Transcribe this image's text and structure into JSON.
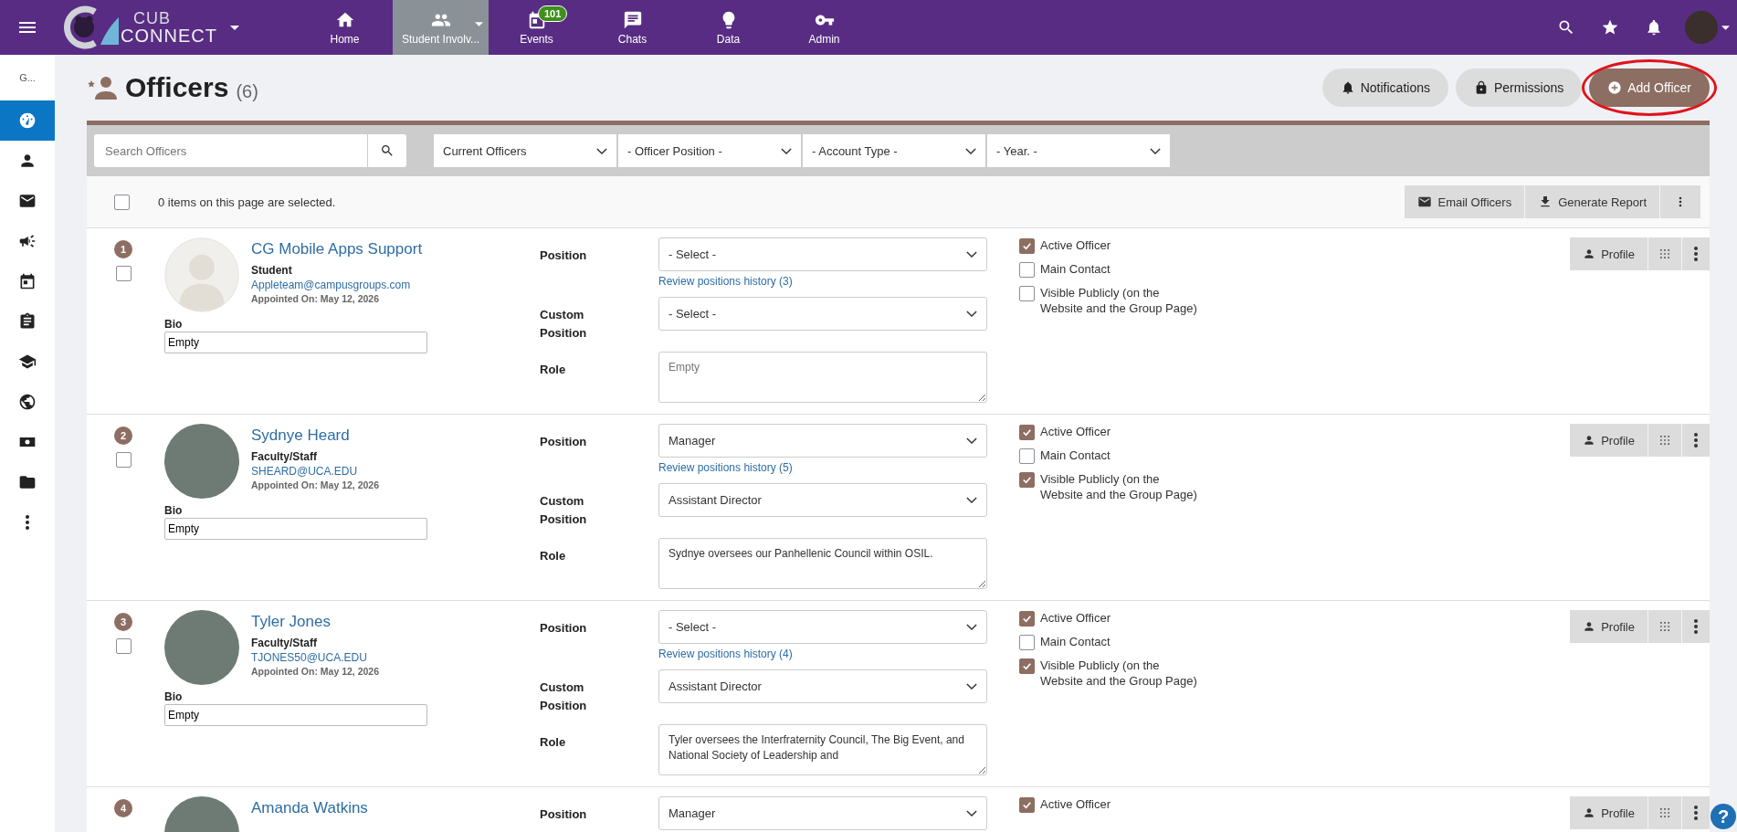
{
  "topbar": {
    "logo": {
      "line1": "CUB",
      "line2": "CONNECT"
    },
    "nav": [
      {
        "kind": "home",
        "label": "Home",
        "selected": false
      },
      {
        "kind": "group",
        "label": "Student Involv...",
        "selected": true,
        "dropdown": true
      },
      {
        "kind": "event",
        "label": "Events",
        "selected": false,
        "badge": "101"
      },
      {
        "kind": "chat",
        "label": "Chats",
        "selected": false
      },
      {
        "kind": "bulb",
        "label": "Data",
        "selected": false
      },
      {
        "kind": "key",
        "label": "Admin",
        "selected": false
      }
    ],
    "tools": [
      {
        "kind": "search"
      },
      {
        "kind": "star"
      },
      {
        "kind": "bell"
      }
    ]
  },
  "sidebar": {
    "label": "G...",
    "items": [
      {
        "kind": "dashboard",
        "selected": true
      },
      {
        "kind": "person",
        "selected": false
      },
      {
        "kind": "mail",
        "selected": false
      },
      {
        "kind": "megaphone",
        "selected": false
      },
      {
        "kind": "event",
        "selected": false
      },
      {
        "kind": "clipboard",
        "selected": false
      },
      {
        "kind": "school",
        "selected": false
      },
      {
        "kind": "globe",
        "selected": false
      },
      {
        "kind": "money",
        "selected": false
      },
      {
        "kind": "folder",
        "selected": false
      },
      {
        "kind": "more",
        "selected": false
      }
    ]
  },
  "page": {
    "title": "Officers",
    "count": "(6)",
    "buttons": [
      {
        "kind": "bell",
        "label": "Notifications",
        "primary": false,
        "highlighted": false
      },
      {
        "kind": "lock",
        "label": "Permissions",
        "primary": false,
        "highlighted": false
      },
      {
        "kind": "add",
        "label": "Add Officer",
        "primary": true,
        "highlighted": true
      }
    ]
  },
  "filters": {
    "search_placeholder": "Search Officers",
    "selects": [
      "Current Officers",
      "- Officer Position -",
      "- Account Type -",
      "- Year. -"
    ]
  },
  "selection": {
    "checked": false,
    "text": "0 items on this page are selected.",
    "actions": [
      {
        "kind": "mail",
        "label": "Email Officers"
      },
      {
        "kind": "download",
        "label": "Generate Report"
      },
      {
        "kind": "more"
      }
    ]
  },
  "officers": [
    {
      "number": "1",
      "kind": "placeholder",
      "name": "CG Mobile Apps Support",
      "type": "Student",
      "email": "Appleteam@campusgroups.com",
      "appointed": "Appointed On: May 12, 2026",
      "checked": false,
      "bio_label": "Bio",
      "bio": "Empty",
      "position_label": "Position",
      "position": "- Select -",
      "history": "Review positions history (3)",
      "custom_label": "Custom Position",
      "custom": "- Select -",
      "role_label": "Role",
      "role_placeholder": "Empty",
      "flags": [
        {
          "label": "Active Officer",
          "checked": true
        },
        {
          "label": "Main Contact",
          "checked": false
        },
        {
          "label": "Visible Publicly (on the Website and the Group Page)",
          "checked": false
        }
      ],
      "profile": "Profile"
    },
    {
      "number": "2",
      "kind": "photo",
      "name": "Sydnye Heard",
      "type": "Faculty/Staff",
      "email": "SHEARD@UCA.EDU",
      "appointed": "Appointed On: May 12, 2026",
      "checked": false,
      "bio_label": "Bio",
      "bio": "Empty",
      "position_label": "Position",
      "position": "Manager",
      "history": "Review positions history (5)",
      "custom_label": "Custom Position",
      "custom": "Assistant Director",
      "role_label": "Role",
      "role": "Sydnye oversees our Panhellenic Council within OSIL.",
      "flags": [
        {
          "label": "Active Officer",
          "checked": true
        },
        {
          "label": "Main Contact",
          "checked": false
        },
        {
          "label": "Visible Publicly (on the Website and the Group Page)",
          "checked": true
        }
      ],
      "profile": "Profile"
    },
    {
      "number": "3",
      "kind": "photo",
      "name": "Tyler Jones",
      "type": "Faculty/Staff",
      "email": "TJONES50@UCA.EDU",
      "appointed": "Appointed On: May 12, 2026",
      "checked": false,
      "bio_label": "Bio",
      "bio": "Empty",
      "position_label": "Position",
      "position": "- Select -",
      "history": "Review positions history (4)",
      "custom_label": "Custom Position",
      "custom": "Assistant Director",
      "role_label": "Role",
      "role": "Tyler oversees the Interfraternity Council, The Big Event, and National Society of Leadership and",
      "flags": [
        {
          "label": "Active Officer",
          "checked": true
        },
        {
          "label": "Main Contact",
          "checked": false
        },
        {
          "label": "Visible Publicly (on the Website and the Group Page)",
          "checked": true
        }
      ],
      "profile": "Profile"
    },
    {
      "number": "4",
      "kind": "photo",
      "name": "Amanda Watkins",
      "position_label": "Position",
      "position": "Manager",
      "flags": [
        {
          "label": "Active Officer",
          "checked": true
        }
      ],
      "profile": "Profile"
    }
  ],
  "help": "?"
}
